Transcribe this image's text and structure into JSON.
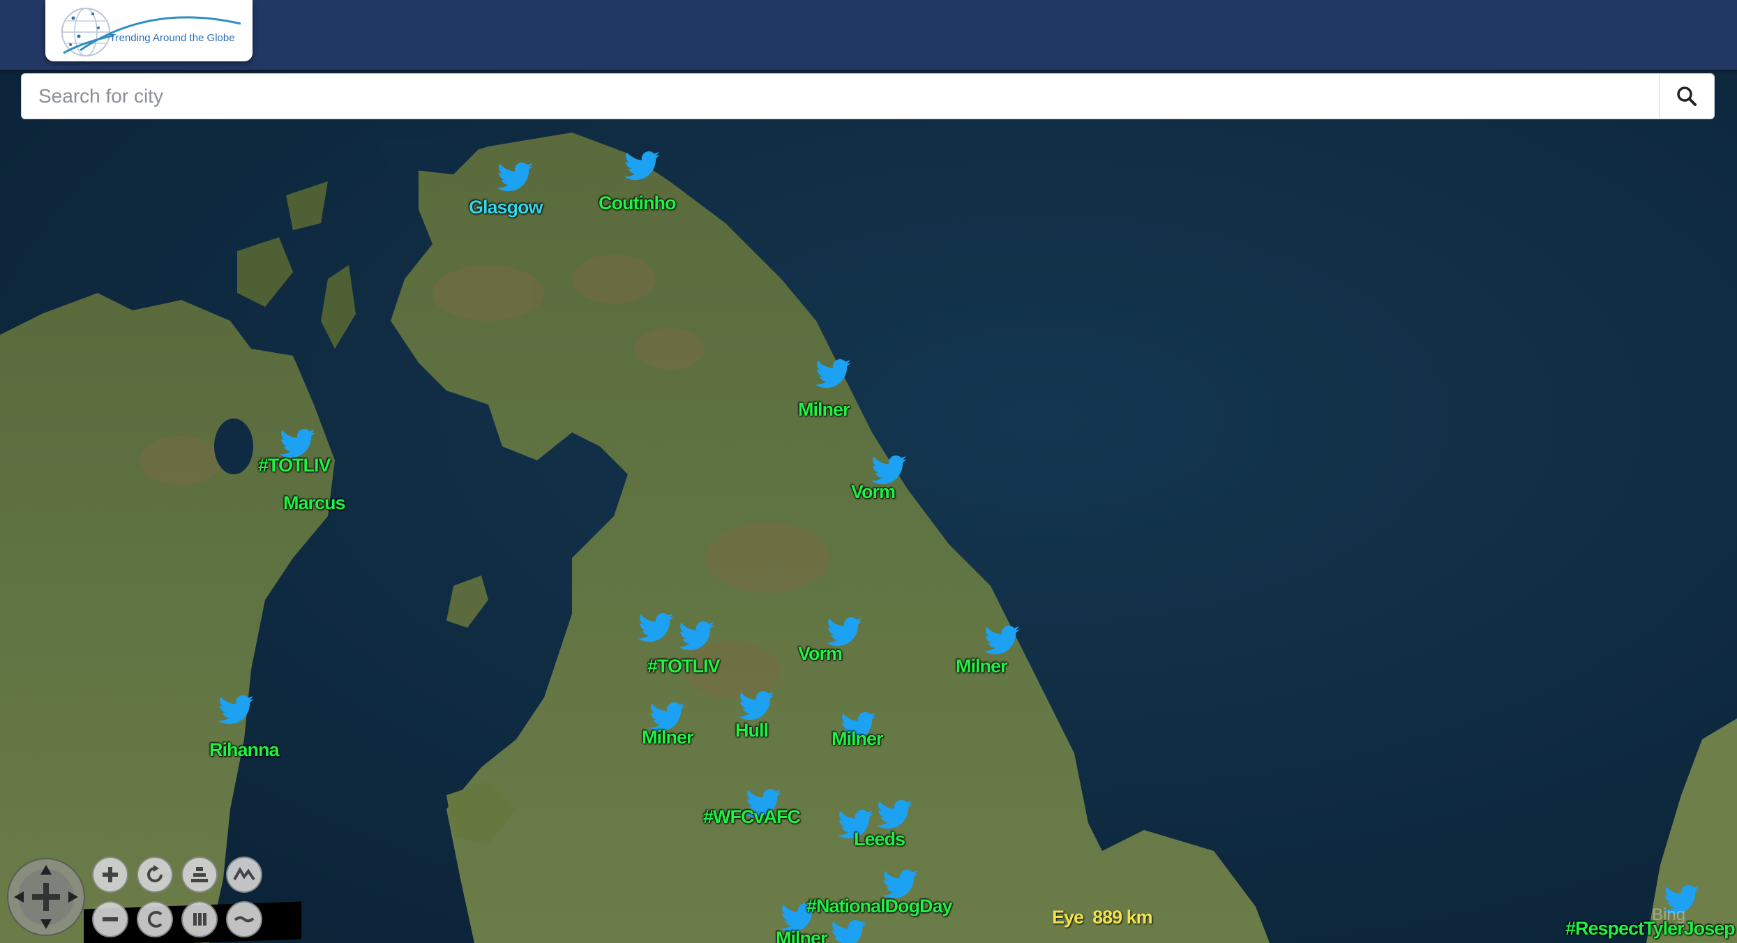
{
  "header": {
    "logo_text": "Trending Around the Globe",
    "background": "#223864"
  },
  "search": {
    "placeholder": "Search for city",
    "value": ""
  },
  "markers": [
    {
      "label": "Glasgow",
      "color": "#35d6e8"
    },
    {
      "label": "Coutinho",
      "color": "#1ff244"
    },
    {
      "label": "Milner",
      "color": "#1ff244"
    },
    {
      "label": "#TOTLIV",
      "color": "#1ff244"
    },
    {
      "label": "Marcus",
      "color": "#1ff244"
    },
    {
      "label": "Vorm",
      "color": "#1ff244"
    },
    {
      "label": "#TOTLIV",
      "color": "#1ff244"
    },
    {
      "label": "Vorm",
      "color": "#1ff244"
    },
    {
      "label": "Milner",
      "color": "#1ff244"
    },
    {
      "label": "Milner",
      "color": "#1ff244"
    },
    {
      "label": "Hull",
      "color": "#1ff244"
    },
    {
      "label": "Milner",
      "color": "#1ff244"
    },
    {
      "label": "Rihanna",
      "color": "#1ff244"
    },
    {
      "label": "#WFCvAFC",
      "color": "#1ff244"
    },
    {
      "label": "Leeds",
      "color": "#1ff244"
    },
    {
      "label": "#NationalDogDay",
      "color": "#1ff244"
    },
    {
      "label": "Milner",
      "color": "#1ff244"
    },
    {
      "label": "#RespectTylerJosep",
      "color": "#1ff244"
    }
  ],
  "status": {
    "eye_label": "Eye",
    "eye_value": "889 km"
  },
  "attribution": "Bing",
  "icons": {
    "marker": "twitter-bird-icon",
    "search": "search-icon",
    "controls": [
      "zoom-in-icon",
      "rotate-icon",
      "tilt-icon",
      "terrain-icon",
      "zoom-out-icon",
      "reset-icon",
      "pause-icon",
      "flat-icon",
      "compass-icon"
    ]
  },
  "colors": {
    "bird": "#1da1f2",
    "eye_text": "#f1e24d",
    "label_green": "#1ff244",
    "label_cyan": "#35d6e8"
  }
}
